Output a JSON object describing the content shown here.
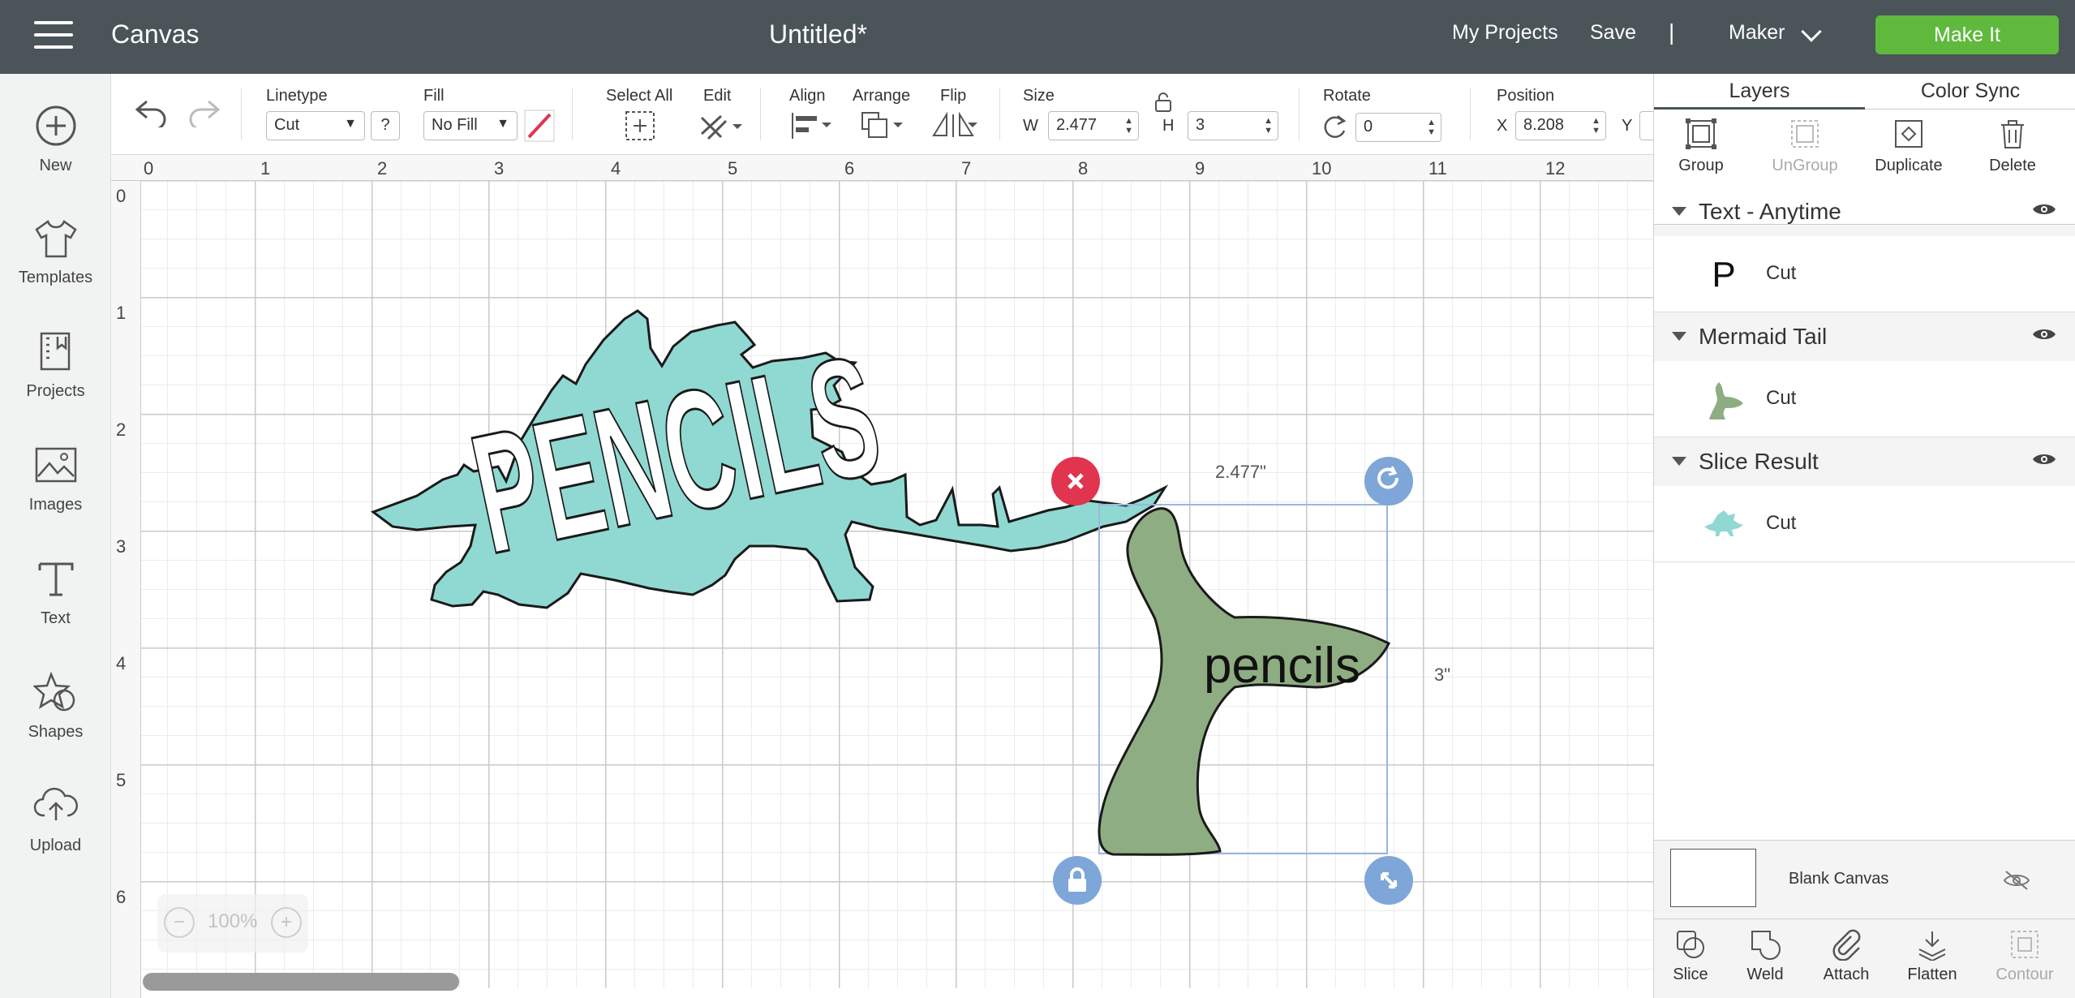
{
  "header": {
    "app_title": "Canvas",
    "doc_title": "Untitled*",
    "my_projects": "My Projects",
    "save": "Save",
    "separator": "|",
    "machine": "Maker",
    "make_it": "Make It"
  },
  "leftbar": {
    "new": "New",
    "templates": "Templates",
    "projects": "Projects",
    "images": "Images",
    "text": "Text",
    "shapes": "Shapes",
    "upload": "Upload"
  },
  "toolbar": {
    "linetype_label": "Linetype",
    "linetype_value": "Cut",
    "help": "?",
    "fill_label": "Fill",
    "fill_value": "No Fill",
    "select_all": "Select All",
    "edit": "Edit",
    "align": "Align",
    "arrange": "Arrange",
    "flip": "Flip",
    "size_label": "Size",
    "w_label": "W",
    "w_value": "2.477",
    "h_label": "H",
    "h_value": "3",
    "rotate_label": "Rotate",
    "rotate_value": "0",
    "position_label": "Position",
    "x_label": "X",
    "x_value": "8.208",
    "y_label": "Y"
  },
  "ruler": {
    "h": [
      "0",
      "1",
      "2",
      "3",
      "4",
      "5",
      "6",
      "7",
      "8",
      "9",
      "10",
      "11",
      "12"
    ],
    "v": [
      "0",
      "1",
      "2",
      "3",
      "4",
      "5",
      "6"
    ]
  },
  "canvas": {
    "dino_text": "PENCILS",
    "tail_text": "pencils",
    "width_dim": "2.477\"",
    "height_dim": "3\"",
    "zoom": "100%"
  },
  "panel": {
    "tab_layers": "Layers",
    "tab_color_sync": "Color Sync",
    "actions": {
      "group": "Group",
      "ungroup": "UnGroup",
      "duplicate": "Duplicate",
      "delete": "Delete"
    },
    "layers": [
      {
        "name": "Text - Anytime",
        "type": "Cut",
        "thumb": "P"
      },
      {
        "name": "Mermaid Tail",
        "type": "Cut"
      },
      {
        "name": "Slice Result",
        "type": "Cut"
      }
    ],
    "blank_canvas": "Blank Canvas",
    "bottom": {
      "slice": "Slice",
      "weld": "Weld",
      "attach": "Attach",
      "flatten": "Flatten",
      "contour": "Contour"
    }
  },
  "colors": {
    "topbar": "#4a5459",
    "make_it": "#5fb93d",
    "dino": "#8fd9d2",
    "tail": "#8fad82",
    "delete_handle": "#e0344f",
    "handle": "#7ea6d8"
  }
}
